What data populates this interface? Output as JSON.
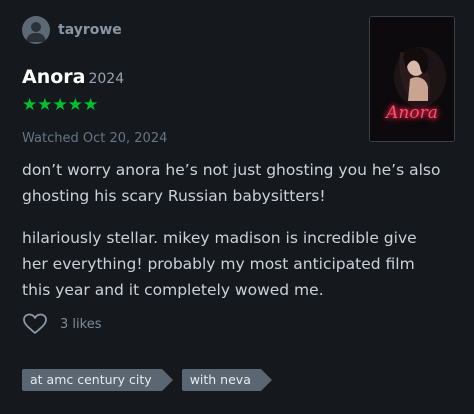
{
  "user": {
    "name": "tayrowe"
  },
  "film": {
    "title": "Anora",
    "year": "2024",
    "poster_text": "Anora"
  },
  "rating": {
    "stars": 5,
    "display": "★★★★★"
  },
  "watched": "Watched Oct 20, 2024",
  "review": {
    "paragraphs": [
      "don’t worry anora he’s not just ghosting you he’s also ghosting his scary Russian babysitters!",
      "hilariously stellar. mikey madison is incredible give her everything! probably my most anticipated film this year and it completely wowed me."
    ]
  },
  "likes": {
    "count": "3 likes"
  },
  "tags": [
    "at amc century city",
    "with neva"
  ],
  "colors": {
    "background": "#15191d",
    "stars": "#00c030",
    "tag": "#5a6672",
    "poster_title": "#ff4d6a"
  },
  "icons": {
    "avatar": "person-icon",
    "like": "heart-outline-icon"
  }
}
